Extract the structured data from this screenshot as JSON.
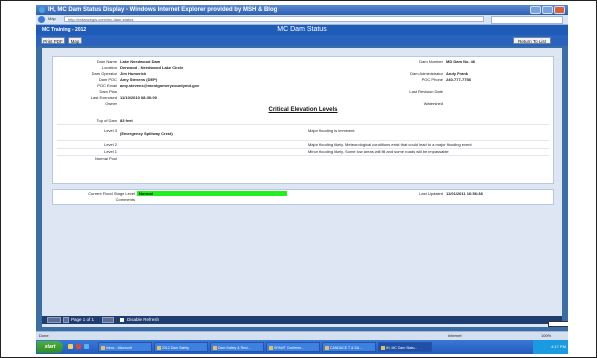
{
  "window": {
    "title": "IH, MC Dam Status Display - Windows Internet Explorer provided by MSH & Blog",
    "url": "http://reliancegis.com/mc-dam-status",
    "tab_label": "Map"
  },
  "app": {
    "header_left": "MC Training - 2012",
    "page_title": "MC Dam Status"
  },
  "toolbar": {
    "print_label": "Print PDF",
    "map_label": "Map",
    "return_label": "Return To List"
  },
  "details": {
    "left": [
      {
        "label": "Dam Name",
        "value": "Lake Needwood Dam"
      },
      {
        "label": "Location",
        "value": "Derwood - Needwood Lake Circle"
      },
      {
        "label": "Dam Operator",
        "value": "Jim Humerick"
      },
      {
        "label": "Dam POC",
        "value": "Amy Stevens (DEP)"
      },
      {
        "label": "POC Email",
        "value": "amy.stevens@montgomerycountymd.gov"
      },
      {
        "label": "Dam Plan",
        "value": ""
      },
      {
        "label": "Last Exercised",
        "value": "11/10/2010 08:30:00"
      },
      {
        "label": "Owner",
        "value": ""
      }
    ],
    "right": [
      {
        "label": "Dam Number",
        "value": "MD Dam No. 46"
      },
      {
        "label": "Dam Administrator",
        "value": "Andy Frank"
      },
      {
        "label": "POC Phone",
        "value": "240-777-7758"
      },
      {
        "label": "Last Revision Date",
        "value": ""
      },
      {
        "label": "Watershed",
        "value": ""
      }
    ]
  },
  "critical": {
    "heading": "Critical Elevation Levels",
    "top_label": "Top of Dam",
    "top_value": "83 feet",
    "levels": [
      {
        "label": "Level 3",
        "value": "(Emergency Spillway Crest)",
        "desc": "Major flooding is imminent"
      },
      {
        "label": "Level 2",
        "value": "",
        "desc": "Major flooding likely. Meteorological conditions exist that could lead to a major flooding event"
      },
      {
        "label": "Level 1",
        "value": "",
        "desc": "Minor flooding likely. Some low areas will fill and some roads will be impassable"
      },
      {
        "label": "Normal Pool",
        "value": "",
        "desc": ""
      }
    ]
  },
  "status": {
    "flood_label": "Current Flood Stage Level",
    "flood_value": "Normal",
    "flood_color": "#22ee22",
    "comments_label": "Comments",
    "updated_label": "Last Updated",
    "updated_value": "11/01/2011 16:56:38"
  },
  "pager": {
    "page_text": "Page 1 of 1",
    "refresh_label": "Disable Refresh"
  },
  "statusbar": {
    "left": "Done",
    "zone": "Internet",
    "zoom": "100%"
  },
  "taskbar": {
    "start_label": "start",
    "buttons": [
      "Inbox - Microsoft",
      "2012 Dam Safety",
      "Dam Safety & Resi...",
      "SFAWT Conferen...",
      "CANDACE T & SA...",
      "IH, MC Dam Statu..."
    ],
    "clock": "4:17 PM"
  }
}
